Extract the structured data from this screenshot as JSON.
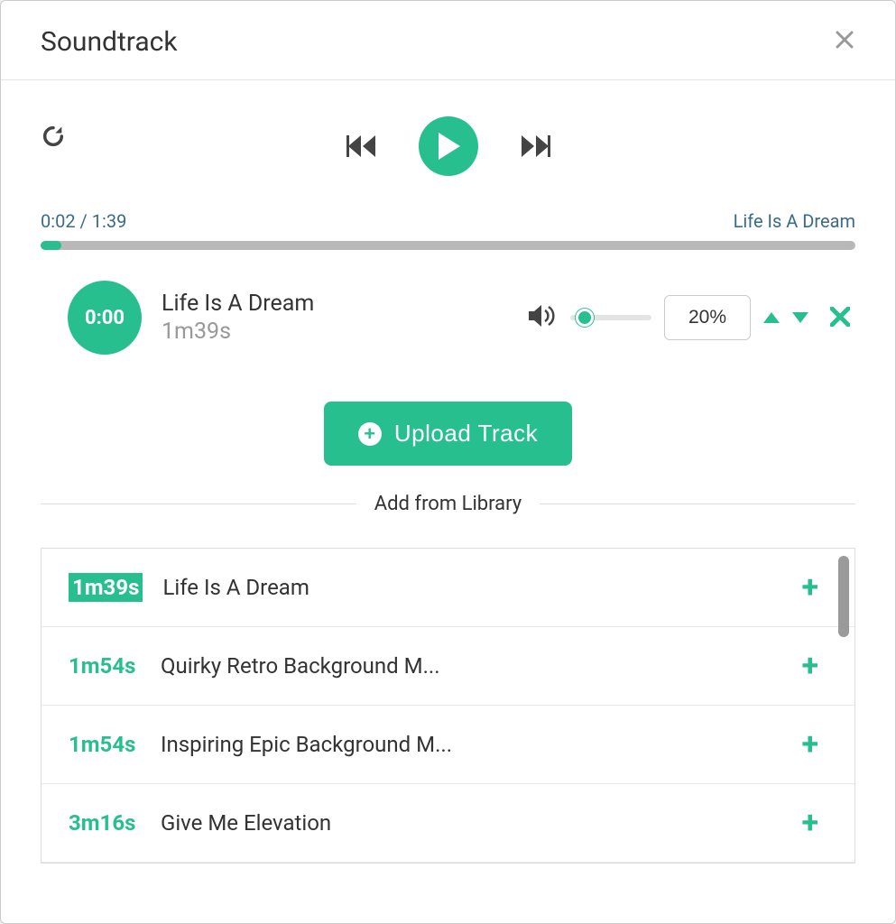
{
  "header": {
    "title": "Soundtrack"
  },
  "player": {
    "time_display": "0:02 / 1:39",
    "now_playing": "Life Is A Dream",
    "progress_percent": 2.5
  },
  "current_track": {
    "badge_time": "0:00",
    "title": "Life Is A Dream",
    "duration": "1m39s",
    "volume": "20%"
  },
  "upload": {
    "label": "Upload Track"
  },
  "library": {
    "heading": "Add from Library",
    "items": [
      {
        "duration": "1m39s",
        "title": "Life Is A Dream",
        "selected": true
      },
      {
        "duration": "1m54s",
        "title": "Quirky Retro Background M...",
        "selected": false
      },
      {
        "duration": "1m54s",
        "title": "Inspiring Epic Background M...",
        "selected": false
      },
      {
        "duration": "3m16s",
        "title": "Give Me Elevation",
        "selected": false
      }
    ]
  },
  "colors": {
    "accent": "#28bf8f"
  }
}
